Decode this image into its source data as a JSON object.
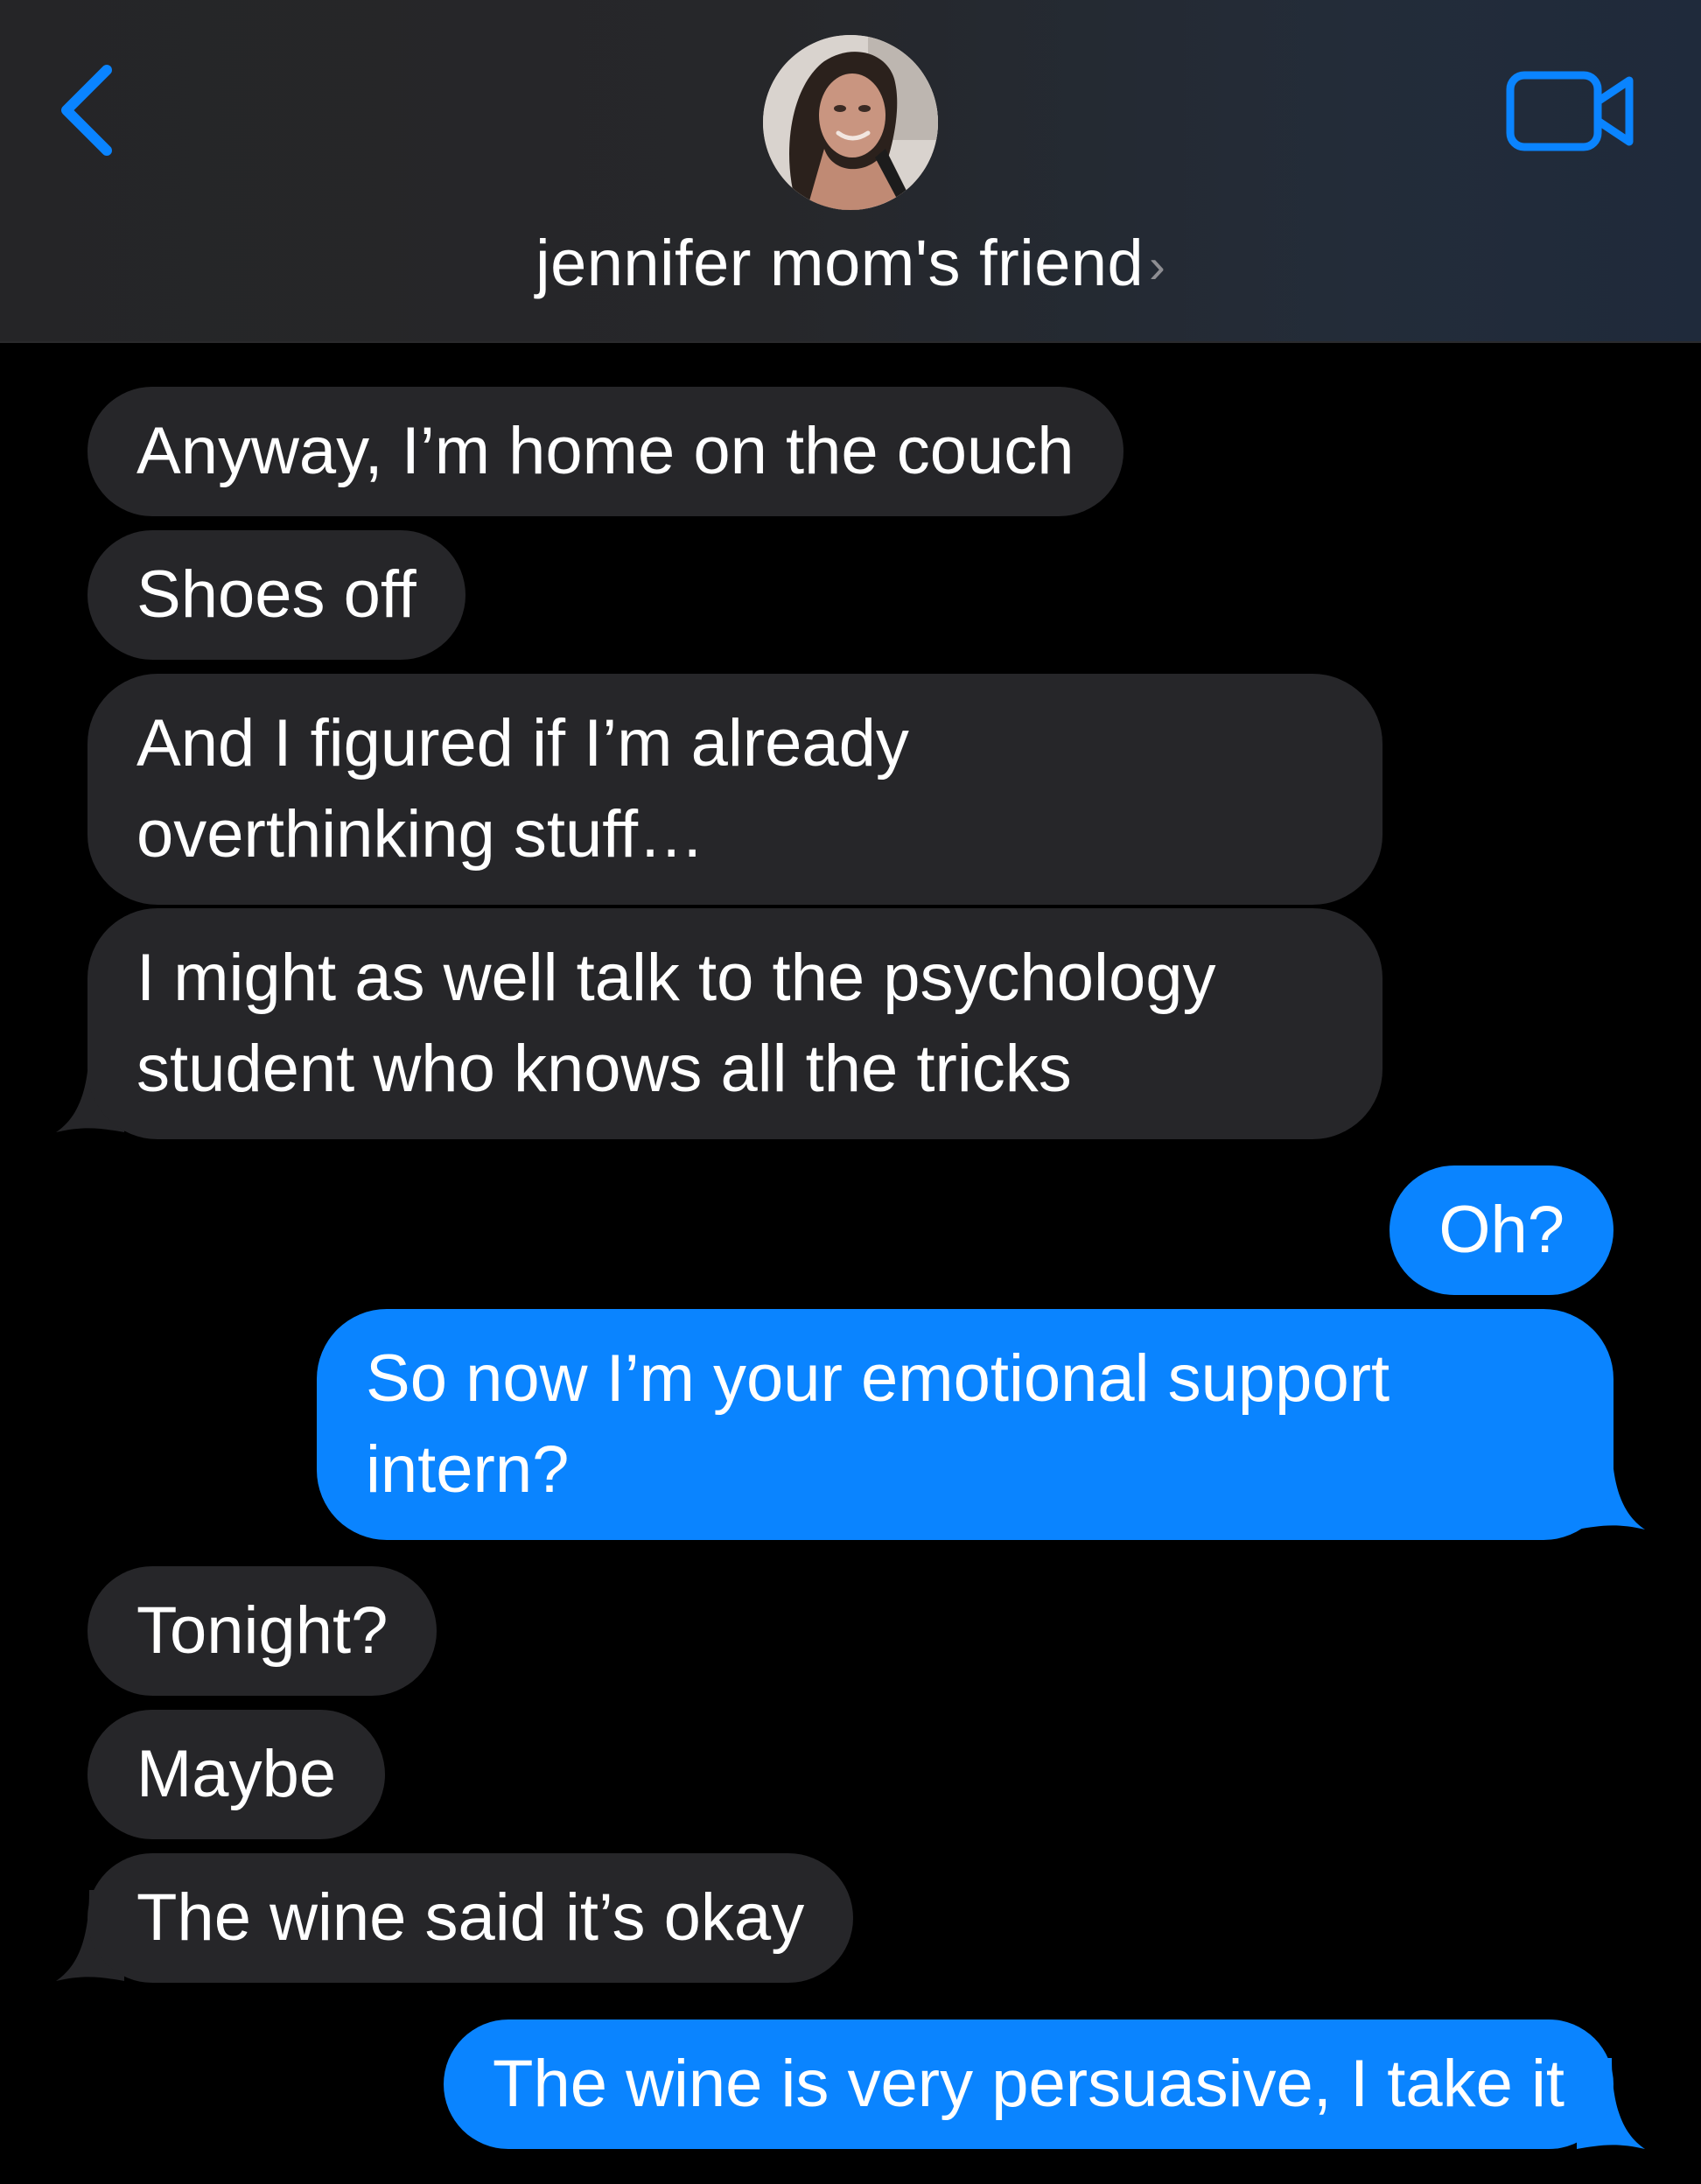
{
  "header": {
    "contact_name": "jennifer mom's friend",
    "chevron": "›",
    "back_icon": "chevron-left-icon",
    "video_icon": "video-camera-icon",
    "accent_color": "#0a84ff"
  },
  "colors": {
    "incoming_bubble": "#262629",
    "outgoing_bubble": "#0a84ff",
    "background": "#000000"
  },
  "messages": [
    {
      "from": "contact",
      "text": "Anyway, I’m home on the couch"
    },
    {
      "from": "contact",
      "text": "Shoes off"
    },
    {
      "from": "contact",
      "lines": [
        "And I figured if I’m already",
        "overthinking stuff…"
      ]
    },
    {
      "from": "contact",
      "lines": [
        "I might as well talk to the psychology",
        "student who knows all the tricks"
      ]
    },
    {
      "from": "me",
      "text": "Oh?"
    },
    {
      "from": "me",
      "lines": [
        "So now I’m your emotional support",
        "intern?"
      ]
    },
    {
      "from": "contact",
      "text": "Tonight?"
    },
    {
      "from": "contact",
      "text": "Maybe"
    },
    {
      "from": "contact",
      "text": "The wine said it’s okay"
    },
    {
      "from": "me",
      "text": "The wine is very persuasive, I take it"
    }
  ]
}
